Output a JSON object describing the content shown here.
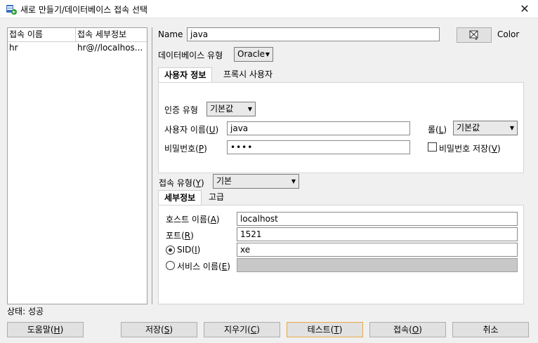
{
  "window": {
    "title": "새로 만들기/데이터베이스 접속 선택",
    "close_glyph": "✕"
  },
  "connections": {
    "headers": [
      "접속 이름",
      "접속 세부정보"
    ],
    "rows": [
      {
        "name": "hr",
        "details": "hr@//localhos..."
      }
    ]
  },
  "form": {
    "name_label": "Name",
    "name_value": "java",
    "color_label": "Color",
    "db_type_label": "데이터베이스 유형",
    "db_type_value": "Oracle",
    "tabs": [
      "사용자 정보",
      "프록시 사용자"
    ],
    "auth_type_label": "인증 유형",
    "auth_type_value": "기본값",
    "username_label": "사용자 이름(",
    "username_key": "U",
    "username_value": "java",
    "role_label": "롤(",
    "role_key": "L",
    "role_value": "기본값",
    "password_label": "비밀번호(",
    "password_key": "P",
    "password_value": "••••",
    "save_pw_label": "비밀번호 저장(",
    "save_pw_key": "V",
    "conn_type_label": "접속 유형(",
    "conn_type_key": "Y",
    "conn_type_value": "기본",
    "detail_tabs": [
      "세부정보",
      "고급"
    ],
    "host_label": "호스트 이름(",
    "host_key": "A",
    "host_value": "localhost",
    "port_label": "포트(",
    "port_key": "R",
    "port_value": "1521",
    "sid_label": "SID(",
    "sid_key": "I",
    "sid_value": "xe",
    "service_label": "서비스 이름(",
    "service_key": "E",
    "close_paren": ")"
  },
  "status": {
    "text": "상태: 성공"
  },
  "buttons": {
    "help": "도움말(",
    "help_key": "H",
    "save": "저장(",
    "save_key": "S",
    "clear": "지우기(",
    "clear_key": "C",
    "test": "테스트(",
    "test_key": "T",
    "connect": "접속(",
    "connect_key": "O",
    "cancel": "취소"
  },
  "colors": {
    "focus_border": "#e8a94a",
    "icon_green": "#2e9e3a",
    "icon_blue": "#3a6fc4"
  }
}
